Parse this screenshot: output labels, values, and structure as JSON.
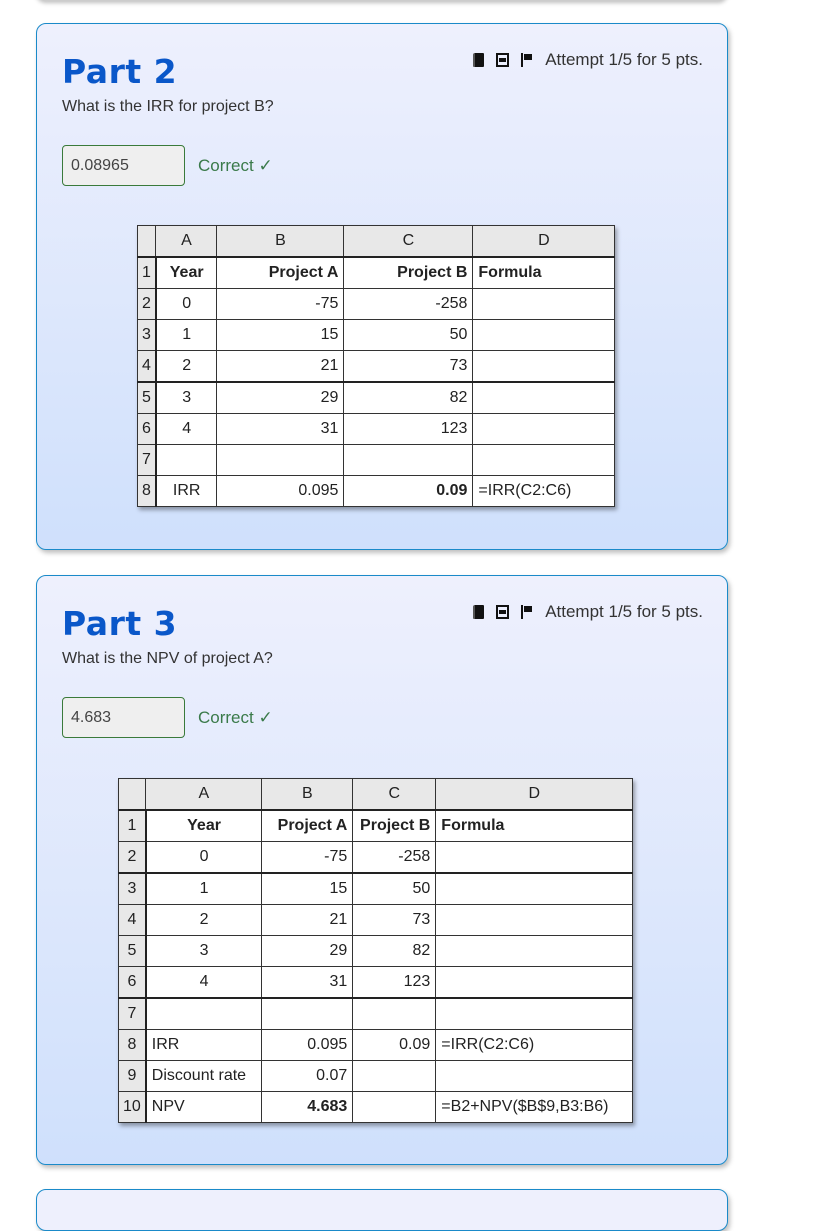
{
  "parts": [
    {
      "title": "Part 2",
      "question": "What is the IRR for project B?",
      "meta_icons": [
        "book-icon",
        "film-icon",
        "flag-icon"
      ],
      "attempt": "Attempt 1/5 for 5 pts.",
      "answer": "0.08965",
      "status": "Correct ✓",
      "sheet": {
        "columns": [
          "",
          "A",
          "B",
          "C",
          "D"
        ],
        "rows": [
          [
            "1",
            "Year",
            "Project A",
            "Project B",
            "Formula"
          ],
          [
            "2",
            "0",
            "-75",
            "-258",
            ""
          ],
          [
            "3",
            "1",
            "15",
            "50",
            ""
          ],
          [
            "4",
            "2",
            "21",
            "73",
            ""
          ],
          [
            "5",
            "3",
            "29",
            "82",
            ""
          ],
          [
            "6",
            "4",
            "31",
            "123",
            ""
          ],
          [
            "7",
            "",
            "",
            "",
            ""
          ],
          [
            "8",
            "IRR",
            "0.095",
            "0.09",
            "=IRR(C2:C6)"
          ]
        ]
      }
    },
    {
      "title": "Part 3",
      "question": "What is the NPV of project A?",
      "meta_icons": [
        "book-icon",
        "film-icon",
        "flag-icon"
      ],
      "attempt": "Attempt 1/5 for 5 pts.",
      "answer": "4.683",
      "status": "Correct ✓",
      "sheet": {
        "columns": [
          "",
          "A",
          "B",
          "C",
          "D"
        ],
        "rows": [
          [
            "1",
            "Year",
            "Project A",
            "Project B",
            "Formula"
          ],
          [
            "2",
            "0",
            "-75",
            "-258",
            ""
          ],
          [
            "3",
            "1",
            "15",
            "50",
            ""
          ],
          [
            "4",
            "2",
            "21",
            "73",
            ""
          ],
          [
            "5",
            "3",
            "29",
            "82",
            ""
          ],
          [
            "6",
            "4",
            "31",
            "123",
            ""
          ],
          [
            "7",
            "",
            "",
            "",
            ""
          ],
          [
            "8",
            "IRR",
            "0.095",
            "0.09",
            "=IRR(C2:C6)"
          ],
          [
            "9",
            "Discount rate",
            "0.07",
            "",
            ""
          ],
          [
            "10",
            "NPV",
            "4.683",
            "",
            "=B2+NPV($B$9,B3:B6)"
          ]
        ]
      }
    }
  ],
  "colors": {
    "title": "#0a57c9",
    "correct": "#3a7a4a",
    "card_border": "#1a8ac9"
  }
}
